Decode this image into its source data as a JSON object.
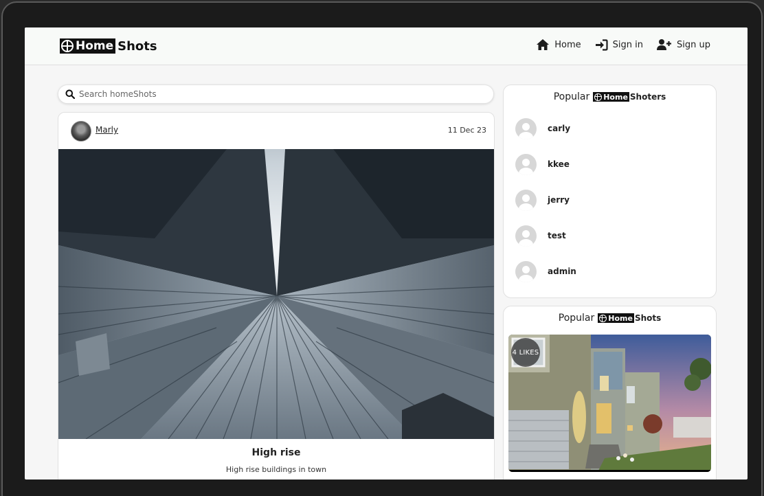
{
  "header": {
    "logo_word1": "Home",
    "logo_word2": "Shots",
    "nav": [
      {
        "label": "Home",
        "icon": "home-icon"
      },
      {
        "label": "Sign in",
        "icon": "sign-in-icon"
      },
      {
        "label": "Sign up",
        "icon": "user-plus-icon"
      }
    ]
  },
  "search": {
    "placeholder": "Search homeShots"
  },
  "post": {
    "username": "Marly",
    "date": "11 Dec 23",
    "title": "High rise",
    "description": "High rise buildings in town"
  },
  "popular_users": {
    "title_prefix": "Popular",
    "logo_word": "Home",
    "title_suffix": "Shoters",
    "users": [
      "carly",
      "kkee",
      "jerry",
      "test",
      "admin"
    ]
  },
  "popular_shots": {
    "title_prefix": "Popular",
    "logo_word": "Home",
    "title_suffix": "Shots",
    "likes_label": "4 LIKES"
  },
  "colors": {
    "frame": "#1b1b1b",
    "page_bg": "#f6f6f6",
    "logo_bg": "#111111",
    "text": "#222222"
  }
}
